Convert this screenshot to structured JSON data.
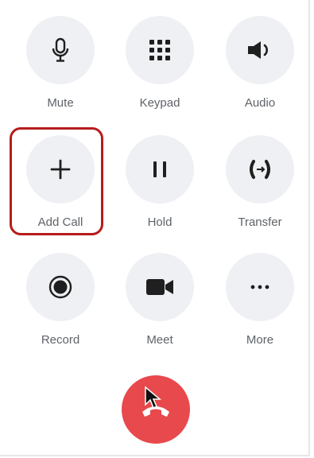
{
  "buttons": {
    "mute": {
      "label": "Mute",
      "icon": "microphone-icon"
    },
    "keypad": {
      "label": "Keypad",
      "icon": "keypad-icon"
    },
    "audio": {
      "label": "Audio",
      "icon": "speaker-icon"
    },
    "add_call": {
      "label": "Add Call",
      "icon": "plus-icon"
    },
    "hold": {
      "label": "Hold",
      "icon": "pause-icon"
    },
    "transfer": {
      "label": "Transfer",
      "icon": "transfer-icon"
    },
    "record": {
      "label": "Record",
      "icon": "record-icon"
    },
    "meet": {
      "label": "Meet",
      "icon": "video-camera-icon"
    },
    "more": {
      "label": "More",
      "icon": "ellipsis-icon"
    }
  },
  "end_call": {
    "icon": "hang-up-icon"
  },
  "colors": {
    "circle_bg": "#eef0f3",
    "icon": "#1f1f1f",
    "label": "#5f6368",
    "highlight": "#b71c1c",
    "end_call": "#e8494c"
  }
}
